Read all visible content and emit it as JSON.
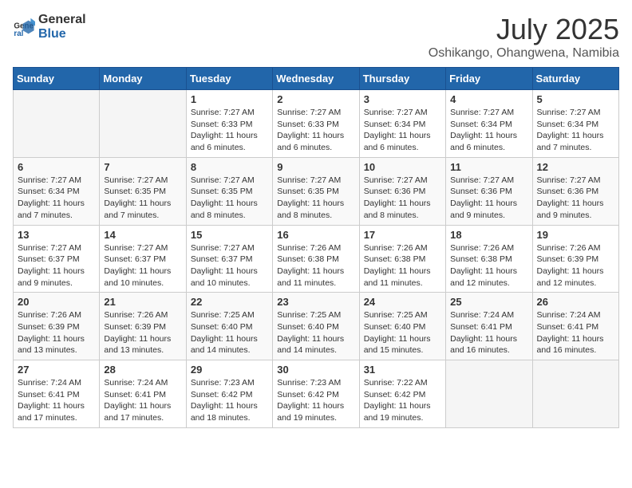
{
  "header": {
    "logo_general": "General",
    "logo_blue": "Blue",
    "month_year": "July 2025",
    "location": "Oshikango, Ohangwena, Namibia"
  },
  "days_of_week": [
    "Sunday",
    "Monday",
    "Tuesday",
    "Wednesday",
    "Thursday",
    "Friday",
    "Saturday"
  ],
  "weeks": [
    [
      {
        "day": "",
        "info": ""
      },
      {
        "day": "",
        "info": ""
      },
      {
        "day": "1",
        "info": "Sunrise: 7:27 AM\nSunset: 6:33 PM\nDaylight: 11 hours and 6 minutes."
      },
      {
        "day": "2",
        "info": "Sunrise: 7:27 AM\nSunset: 6:33 PM\nDaylight: 11 hours and 6 minutes."
      },
      {
        "day": "3",
        "info": "Sunrise: 7:27 AM\nSunset: 6:34 PM\nDaylight: 11 hours and 6 minutes."
      },
      {
        "day": "4",
        "info": "Sunrise: 7:27 AM\nSunset: 6:34 PM\nDaylight: 11 hours and 6 minutes."
      },
      {
        "day": "5",
        "info": "Sunrise: 7:27 AM\nSunset: 6:34 PM\nDaylight: 11 hours and 7 minutes."
      }
    ],
    [
      {
        "day": "6",
        "info": "Sunrise: 7:27 AM\nSunset: 6:34 PM\nDaylight: 11 hours and 7 minutes."
      },
      {
        "day": "7",
        "info": "Sunrise: 7:27 AM\nSunset: 6:35 PM\nDaylight: 11 hours and 7 minutes."
      },
      {
        "day": "8",
        "info": "Sunrise: 7:27 AM\nSunset: 6:35 PM\nDaylight: 11 hours and 8 minutes."
      },
      {
        "day": "9",
        "info": "Sunrise: 7:27 AM\nSunset: 6:35 PM\nDaylight: 11 hours and 8 minutes."
      },
      {
        "day": "10",
        "info": "Sunrise: 7:27 AM\nSunset: 6:36 PM\nDaylight: 11 hours and 8 minutes."
      },
      {
        "day": "11",
        "info": "Sunrise: 7:27 AM\nSunset: 6:36 PM\nDaylight: 11 hours and 9 minutes."
      },
      {
        "day": "12",
        "info": "Sunrise: 7:27 AM\nSunset: 6:36 PM\nDaylight: 11 hours and 9 minutes."
      }
    ],
    [
      {
        "day": "13",
        "info": "Sunrise: 7:27 AM\nSunset: 6:37 PM\nDaylight: 11 hours and 9 minutes."
      },
      {
        "day": "14",
        "info": "Sunrise: 7:27 AM\nSunset: 6:37 PM\nDaylight: 11 hours and 10 minutes."
      },
      {
        "day": "15",
        "info": "Sunrise: 7:27 AM\nSunset: 6:37 PM\nDaylight: 11 hours and 10 minutes."
      },
      {
        "day": "16",
        "info": "Sunrise: 7:26 AM\nSunset: 6:38 PM\nDaylight: 11 hours and 11 minutes."
      },
      {
        "day": "17",
        "info": "Sunrise: 7:26 AM\nSunset: 6:38 PM\nDaylight: 11 hours and 11 minutes."
      },
      {
        "day": "18",
        "info": "Sunrise: 7:26 AM\nSunset: 6:38 PM\nDaylight: 11 hours and 12 minutes."
      },
      {
        "day": "19",
        "info": "Sunrise: 7:26 AM\nSunset: 6:39 PM\nDaylight: 11 hours and 12 minutes."
      }
    ],
    [
      {
        "day": "20",
        "info": "Sunrise: 7:26 AM\nSunset: 6:39 PM\nDaylight: 11 hours and 13 minutes."
      },
      {
        "day": "21",
        "info": "Sunrise: 7:26 AM\nSunset: 6:39 PM\nDaylight: 11 hours and 13 minutes."
      },
      {
        "day": "22",
        "info": "Sunrise: 7:25 AM\nSunset: 6:40 PM\nDaylight: 11 hours and 14 minutes."
      },
      {
        "day": "23",
        "info": "Sunrise: 7:25 AM\nSunset: 6:40 PM\nDaylight: 11 hours and 14 minutes."
      },
      {
        "day": "24",
        "info": "Sunrise: 7:25 AM\nSunset: 6:40 PM\nDaylight: 11 hours and 15 minutes."
      },
      {
        "day": "25",
        "info": "Sunrise: 7:24 AM\nSunset: 6:41 PM\nDaylight: 11 hours and 16 minutes."
      },
      {
        "day": "26",
        "info": "Sunrise: 7:24 AM\nSunset: 6:41 PM\nDaylight: 11 hours and 16 minutes."
      }
    ],
    [
      {
        "day": "27",
        "info": "Sunrise: 7:24 AM\nSunset: 6:41 PM\nDaylight: 11 hours and 17 minutes."
      },
      {
        "day": "28",
        "info": "Sunrise: 7:24 AM\nSunset: 6:41 PM\nDaylight: 11 hours and 17 minutes."
      },
      {
        "day": "29",
        "info": "Sunrise: 7:23 AM\nSunset: 6:42 PM\nDaylight: 11 hours and 18 minutes."
      },
      {
        "day": "30",
        "info": "Sunrise: 7:23 AM\nSunset: 6:42 PM\nDaylight: 11 hours and 19 minutes."
      },
      {
        "day": "31",
        "info": "Sunrise: 7:22 AM\nSunset: 6:42 PM\nDaylight: 11 hours and 19 minutes."
      },
      {
        "day": "",
        "info": ""
      },
      {
        "day": "",
        "info": ""
      }
    ]
  ]
}
